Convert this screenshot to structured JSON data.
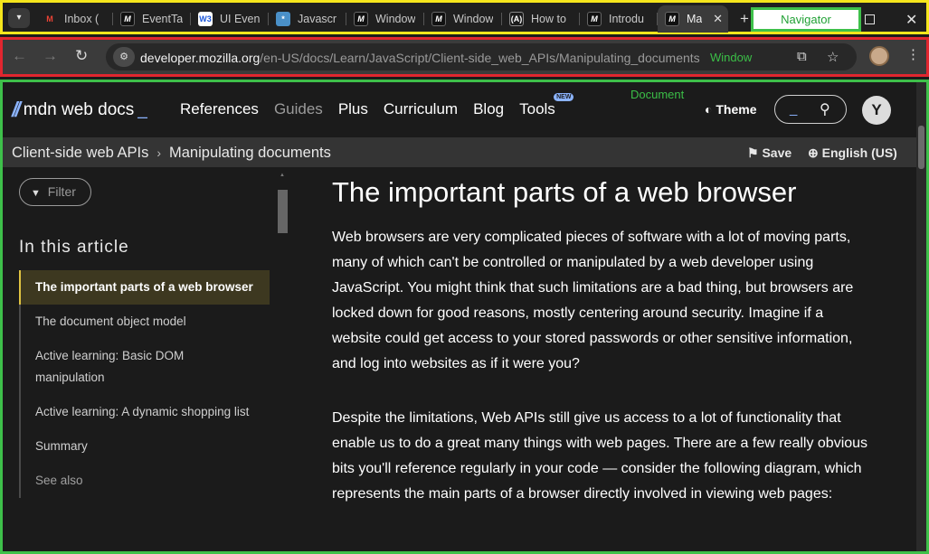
{
  "browser": {
    "tabs": [
      {
        "label": "Inbox (",
        "favicon": "gmail-icon"
      },
      {
        "label": "EventTa",
        "favicon": "mdn-icon"
      },
      {
        "label": "UI Even",
        "favicon": "w3-icon"
      },
      {
        "label": "Javascr",
        "favicon": "css-tricks-icon"
      },
      {
        "label": "Window",
        "favicon": "mdn-icon"
      },
      {
        "label": "Window",
        "favicon": "mdn-icon"
      },
      {
        "label": "How to",
        "favicon": "dev-icon"
      },
      {
        "label": "Introdu",
        "favicon": "mdn-icon"
      },
      {
        "label": "Ma",
        "favicon": "mdn-icon",
        "active": true
      }
    ],
    "navigator_label": "Navigator",
    "url_host": "developer.mozilla.org",
    "url_path": "/en-US/docs/Learn/JavaScript/Client-side_web_APIs/Manipulating_documents",
    "window_label": "Window"
  },
  "document_label": "Document",
  "mdn": {
    "logo_text": "mdn web docs",
    "nav": [
      "References",
      "Guides",
      "Plus",
      "Curriculum",
      "Blog",
      "Tools"
    ],
    "new_badge": "NEW",
    "theme_label": "Theme",
    "user_initial": "Y",
    "breadcrumbs": [
      "Client-side web APIs",
      "Manipulating documents"
    ],
    "save_label": "Save",
    "language_label": "English (US)"
  },
  "sidebar": {
    "filter_placeholder": "Filter",
    "toc_heading": "In this article",
    "toc": [
      "The important parts of a web browser",
      "The document object model",
      "Active learning: Basic DOM manipulation",
      "Active learning: A dynamic shopping list",
      "Summary",
      "See also"
    ]
  },
  "article": {
    "title": "The important parts of a web browser",
    "paragraphs": [
      "Web browsers are very complicated pieces of software with a lot of moving parts, many of which can't be controlled or manipulated by a web developer using JavaScript. You might think that such limitations are a bad thing, but browsers are locked down for good reasons, mostly centering around security. Imagine if a website could get access to your stored passwords or other sensitive information, and log into websites as if it were you?",
      "Despite the limitations, Web APIs still give us access to a lot of functionality that enable us to do a great many things with web pages. There are a few really obvious bits you'll reference regularly in your code — consider the following diagram, which represents the main parts of a browser directly involved in viewing web pages:"
    ]
  },
  "colors": {
    "navigator_box": "#f5e51c",
    "window_box": "#e1262f",
    "document_box": "#3ec04a",
    "mdn_accent": "#8cb4ff",
    "toc_active_bar": "#e0c341"
  }
}
